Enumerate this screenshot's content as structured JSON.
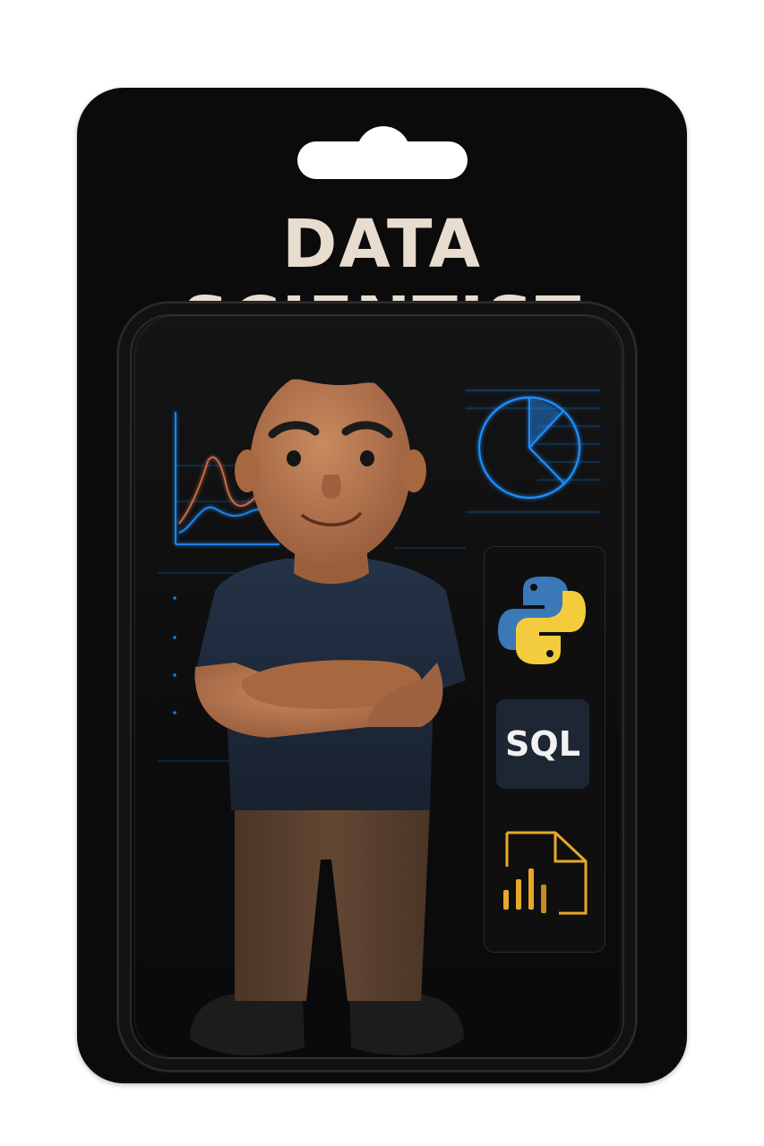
{
  "package": {
    "title": "DATA SCIENTIST"
  },
  "tools": {
    "python_icon": "python-icon",
    "sql_label": "SQL",
    "powerbi_icon": "power-bi-icon"
  },
  "colors": {
    "card": "#0b0b0c",
    "title": "#e7dccd",
    "holo_blue": "#1e90ff",
    "python_blue": "#3a78b8",
    "python_yellow": "#f2cc3c",
    "powerbi_gold": "#e6a82a",
    "shirt": "#1f2a3b",
    "pants": "#5a4230",
    "skin": "#b9784e"
  }
}
